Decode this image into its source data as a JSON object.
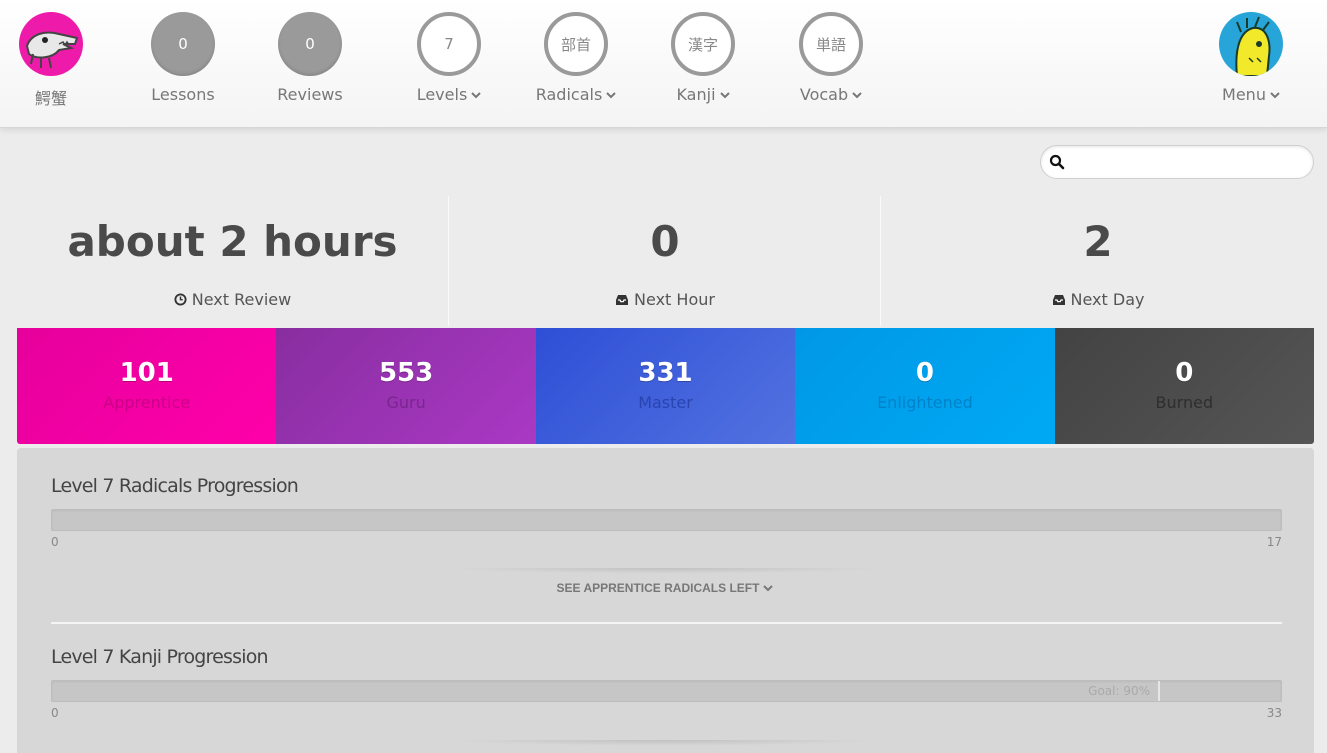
{
  "user": {
    "name": "鰐蟹",
    "avatar_icon": "alligator-avatar-icon"
  },
  "nav": {
    "lessons": {
      "count": "0",
      "label": "Lessons"
    },
    "reviews": {
      "count": "0",
      "label": "Reviews"
    },
    "levels": {
      "value": "7",
      "label": "Levels"
    },
    "radicals": {
      "glyph": "部首",
      "label": "Radicals"
    },
    "kanji": {
      "glyph": "漢字",
      "label": "Kanji"
    },
    "vocab": {
      "glyph": "単語",
      "label": "Vocab"
    },
    "menu": {
      "label": "Menu",
      "avatar_icon": "yellow-face-avatar-icon"
    }
  },
  "search": {
    "placeholder": "",
    "value": ""
  },
  "forecast": [
    {
      "value": "about 2 hours",
      "label": "Next Review",
      "icon": "clock-icon"
    },
    {
      "value": "0",
      "label": "Next Hour",
      "icon": "inbox-icon"
    },
    {
      "value": "2",
      "label": "Next Day",
      "icon": "inbox-icon"
    }
  ],
  "srs": [
    {
      "count": "101",
      "name": "Apprentice",
      "color": "#f100a1"
    },
    {
      "count": "553",
      "name": "Guru",
      "color": "#9e34b7"
    },
    {
      "count": "331",
      "name": "Master",
      "color": "#3f58d4"
    },
    {
      "count": "0",
      "name": "Enlightened",
      "color": "#009ff0"
    },
    {
      "count": "0",
      "name": "Burned",
      "color": "#484848"
    }
  ],
  "progress": {
    "radicals": {
      "title": "Level 7 Radicals Progression",
      "min": "0",
      "max": "17",
      "see_left": "SEE APPRENTICE RADICALS LEFT"
    },
    "kanji": {
      "title": "Level 7 Kanji Progression",
      "min": "0",
      "max": "33",
      "goal_label": "Goal: 90%",
      "goal_fraction": 0.9
    }
  },
  "colors": {
    "nav_circle": "#9a9a9a",
    "panel_bg": "#d7d7d7",
    "page_bg": "#ececec"
  }
}
